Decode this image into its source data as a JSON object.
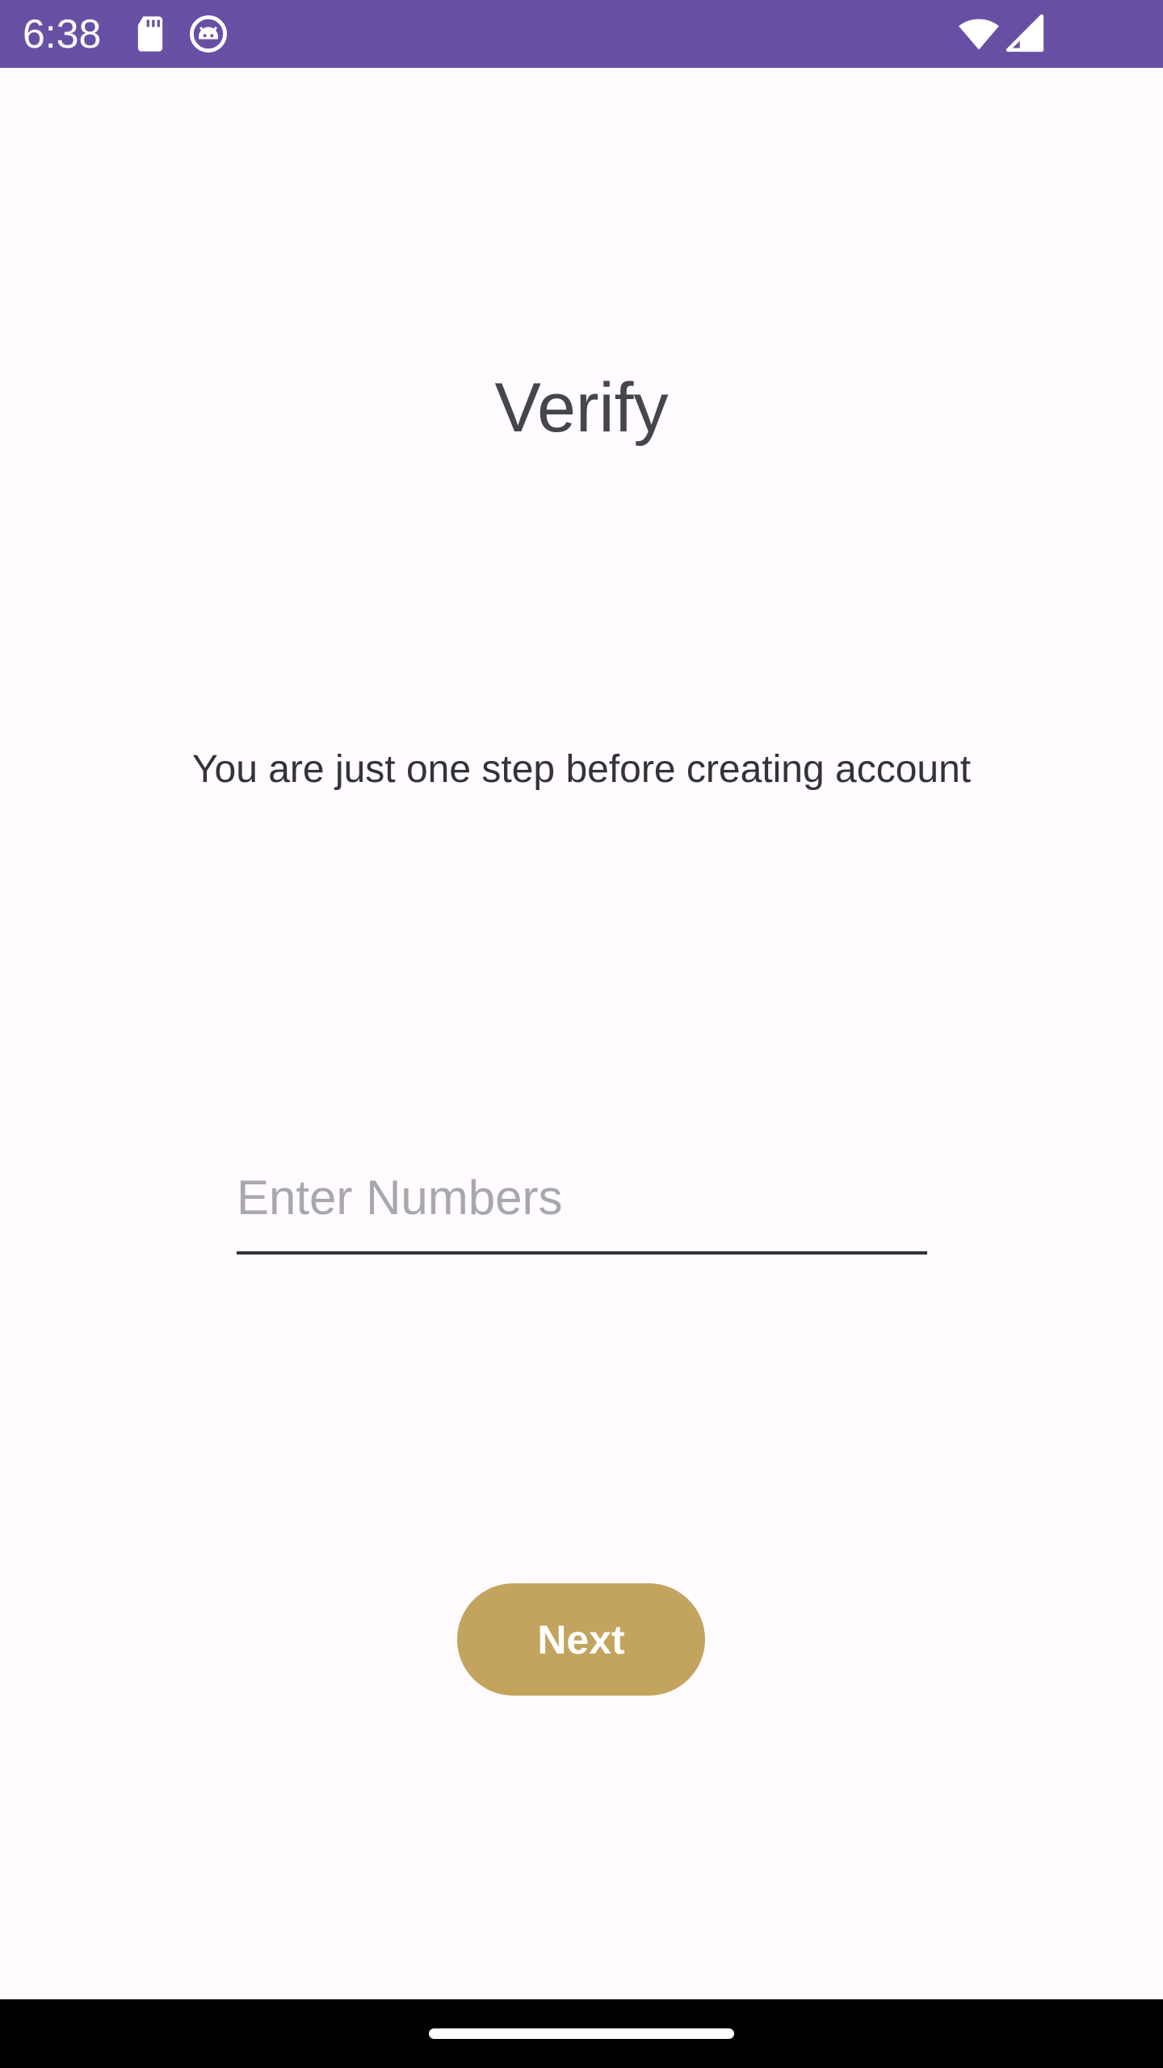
{
  "status_bar": {
    "time": "6:38",
    "icons": [
      "sd-card-icon",
      "android-robot-icon",
      "wifi-icon",
      "cell-signal-icon"
    ],
    "background": "#6750a4"
  },
  "screen": {
    "title": "Verify",
    "subtitle": "You are just one step before creating account",
    "input": {
      "placeholder": "Enter Numbers",
      "value": ""
    },
    "next_button": {
      "label": "Next",
      "color": "#c2a45e"
    }
  },
  "nav_bar": {
    "background": "#000000"
  }
}
